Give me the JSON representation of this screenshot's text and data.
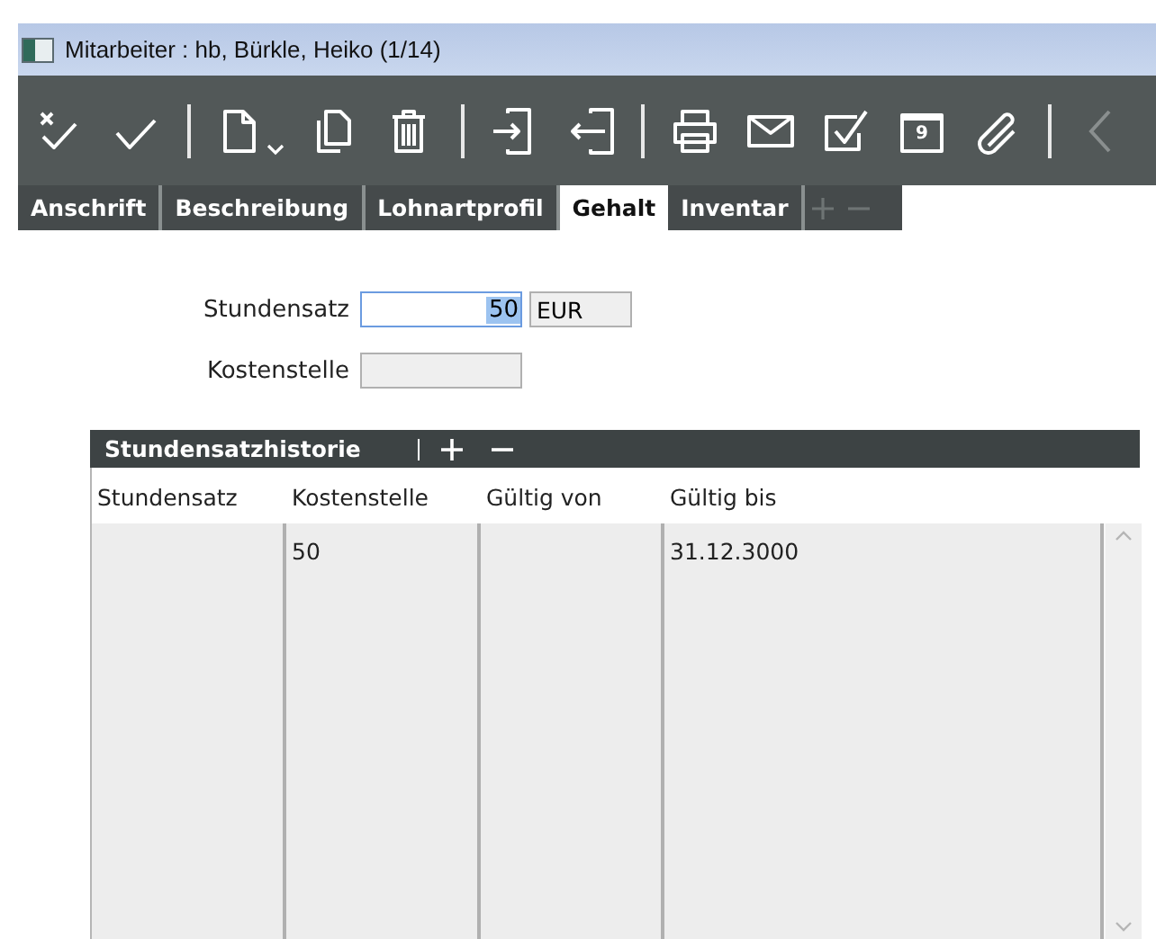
{
  "window": {
    "title": "Mitarbeiter : hb, Bürkle, Heiko (1/14)"
  },
  "toolbar": {
    "calendar_day": "9"
  },
  "tabs": [
    {
      "label": "Anschrift",
      "selected": false
    },
    {
      "label": "Beschreibung",
      "selected": false
    },
    {
      "label": "Lohnartprofil",
      "selected": false
    },
    {
      "label": "Gehalt",
      "selected": true
    },
    {
      "label": "Inventar",
      "selected": false
    }
  ],
  "form": {
    "fields": [
      {
        "label": "Stundensatz",
        "value": "50",
        "unit": "EUR",
        "focused": true
      },
      {
        "label": "Kostenstelle",
        "focused": false
      }
    ]
  },
  "history": {
    "title": "Stundensatzhistorie",
    "columns": [
      "Stundensatz",
      "Kostenstelle",
      "Gültig von",
      "Gültig bis"
    ],
    "rows": [
      {
        "kostenstelle": "50",
        "gueltig_bis": "31.12.3000"
      }
    ]
  }
}
